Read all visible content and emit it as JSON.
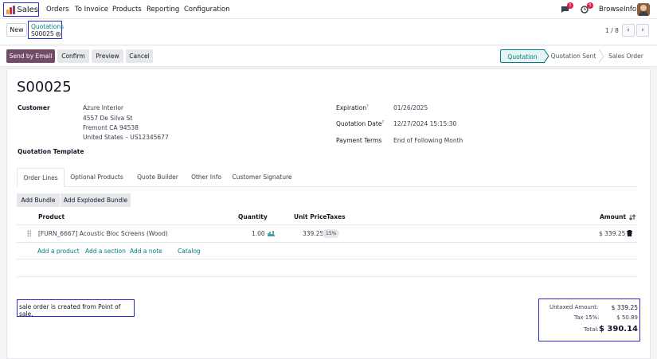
{
  "topbar": {
    "app_name": "Sales",
    "menu": [
      "Orders",
      "To Invoice",
      "Products",
      "Reporting",
      "Configuration"
    ],
    "chat_count": "1",
    "activity_count": "5",
    "company": "BrowseInfo",
    "icons": [
      "sales-app-icon",
      "chat-icon",
      "activity-clock-icon",
      "user-avatar"
    ]
  },
  "controlbar": {
    "new_label": "New",
    "breadcrumb_parent": "Quotations",
    "breadcrumb_current": "S00025",
    "pager": "1 / 8",
    "prev": "‹",
    "next": "›"
  },
  "actions": {
    "send_email": "Send by Email",
    "confirm": "Confirm",
    "preview": "Preview",
    "cancel": "Cancel",
    "statuses": [
      "Quotation",
      "Quotation Sent",
      "Sales Order"
    ],
    "active_status": "Quotation"
  },
  "form": {
    "name": "S00025",
    "customer_label": "Customer",
    "customer_lines": [
      "Azure Interior",
      "4557 De Silva St",
      "Fremont CA 94538",
      "United States – US12345677"
    ],
    "expiration_label": "Expiration",
    "expiration": "01/26/2025",
    "quotation_date_label": "Quotation Date",
    "quotation_date": "12/27/2024 15:15:30",
    "payment_terms_label": "Payment Terms",
    "payment_terms": "End of Following Month",
    "template_label": "Quotation Template",
    "help_mark": "?"
  },
  "tabs": [
    "Order Lines",
    "Optional Products",
    "Quote Builder",
    "Other Info",
    "Customer Signature"
  ],
  "active_tab": "Order Lines",
  "bundle_buttons": [
    "Add Bundle",
    "Add Exploded Bundle"
  ],
  "table": {
    "headers": {
      "product": "Product",
      "quantity": "Quantity",
      "unit_price": "Unit Price",
      "taxes": "Taxes",
      "amount": "Amount"
    },
    "rows": [
      {
        "product": "[FURN_6667] Acoustic Bloc Screens (Wood)",
        "quantity": "1.00",
        "unit_price": "339.25",
        "taxes": "15%",
        "amount": "$ 339.25"
      }
    ],
    "add_links": [
      "Add a product",
      "Add a section",
      "Add a note",
      "Catalog"
    ]
  },
  "note": "sale order is created from Point of sale.",
  "totals": {
    "untaxed_label": "Untaxed Amount:",
    "untaxed": "$ 339.25",
    "tax_label": "Tax 15%:",
    "tax": "$ 50.89",
    "total_label": "Total:",
    "total": "$ 390.14"
  },
  "colors": {
    "brand": "#714b67",
    "accent": "#017e84",
    "highlight_box": "#2b2bd1",
    "badge": "#e11d48"
  }
}
